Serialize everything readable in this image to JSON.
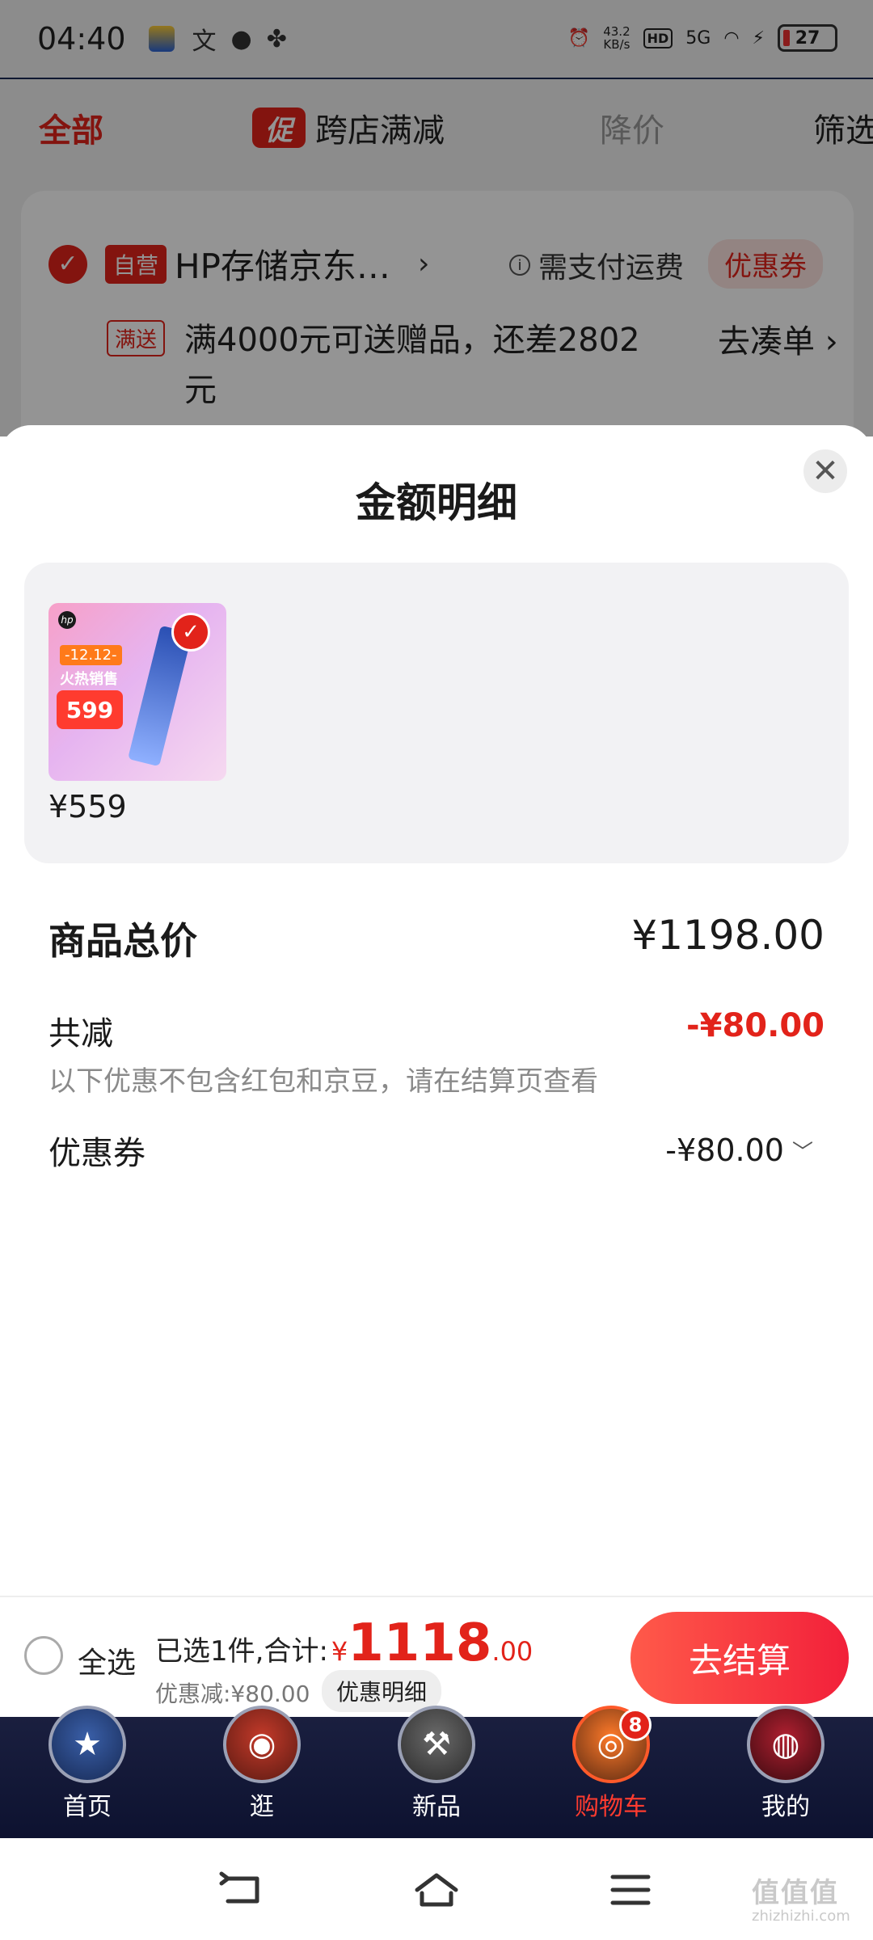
{
  "status_bar": {
    "time": "04:40",
    "network_speed_value": "43.2",
    "network_speed_unit": "KB/s",
    "hd_label": "HD",
    "network_type": "5G",
    "battery": "27"
  },
  "filters": {
    "all": "全部",
    "promo_badge": "促",
    "promo_label": "跨店满减",
    "price_drop": "降价",
    "screen": "筛选"
  },
  "shop": {
    "self_tag": "自营",
    "name": "HP存储京东…",
    "arrow": "›",
    "shipping_icon": "i",
    "shipping_text": "需支付运费",
    "coupon_tag": "优惠券",
    "gift_tag": "满送",
    "gift_text": "满4000元可送赠品，还差2802元",
    "gift_action": "去凑单 ›"
  },
  "sheet": {
    "title": "金额明细",
    "close": "✕",
    "product_price": "¥559",
    "product_badge_1": "-12.12-",
    "product_badge_2": "火热销售",
    "product_tag_price": "599",
    "total_label": "商品总价",
    "total_amount": "¥1198.00",
    "reduce_label": "共减",
    "reduce_amount": "-¥80.00",
    "note": "以下优惠不包含红包和京豆，请在结算页查看",
    "coupon_label": "优惠券",
    "coupon_amount": "-¥80.00"
  },
  "checkout": {
    "select_all": "全选",
    "selected_text": "已选1件,合计:",
    "currency": "¥",
    "total_int": "1118",
    "total_dec": ".00",
    "discount_text": "优惠减:¥80.00",
    "detail_button": "优惠明细",
    "pay_button": "去结算"
  },
  "tabs": [
    {
      "label": "首页",
      "active": false
    },
    {
      "label": "逛",
      "active": false
    },
    {
      "label": "新品",
      "active": false
    },
    {
      "label": "购物车",
      "active": true,
      "badge": "8"
    },
    {
      "label": "我的",
      "active": false
    }
  ],
  "watermark": {
    "main": "值值值",
    "sub": "zhizhizhi.com"
  },
  "colors": {
    "accent": "#e2231a",
    "tabbar": "#141a38"
  }
}
